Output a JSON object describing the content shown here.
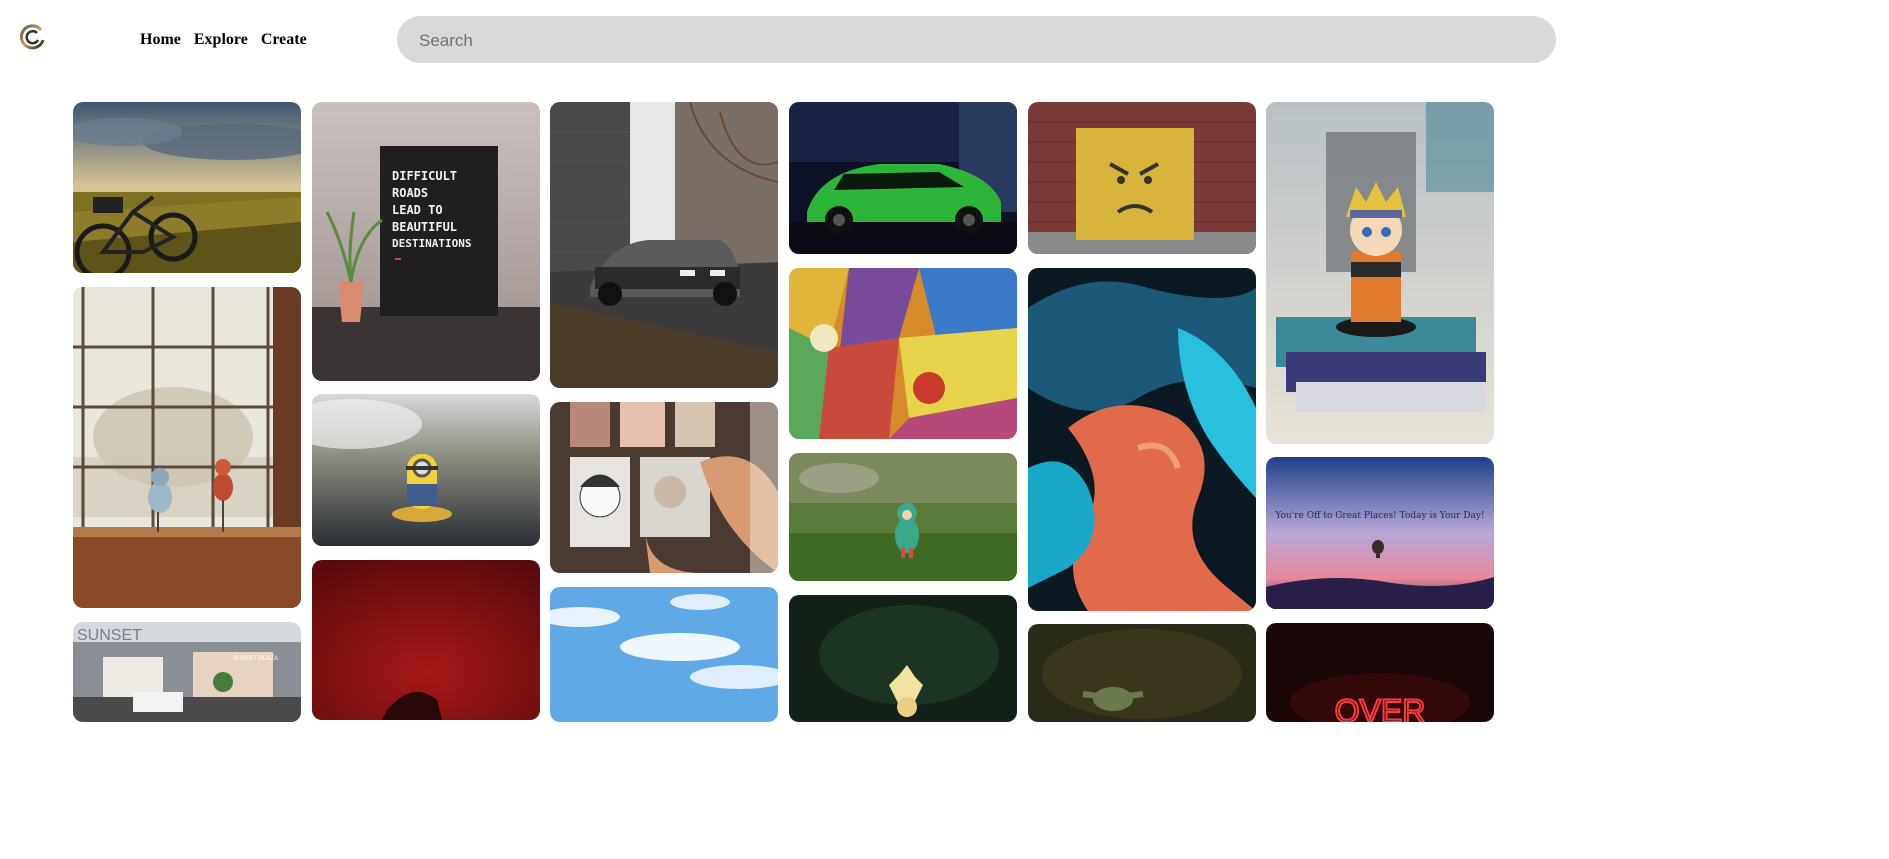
{
  "header": {
    "logo_icon": "circular-swirl-logo",
    "nav": [
      "Home",
      "Explore",
      "Create"
    ],
    "search_placeholder": "Search"
  },
  "colors": {
    "search_bg": "#d9d9d9",
    "page_bg": "#ffffff"
  },
  "photos": {
    "letterboard_text": [
      "DIFFICULT",
      "ROADS",
      "LEAD TO",
      "BEAUTIFUL",
      "DESTINATIONS"
    ],
    "sunset_sign": "SUNSET",
    "sunset_plaza": "SUNSET PLAZA",
    "sky_quote": "You're Off to Great Places! Today is Your Day!",
    "neon_text": "OVER"
  }
}
